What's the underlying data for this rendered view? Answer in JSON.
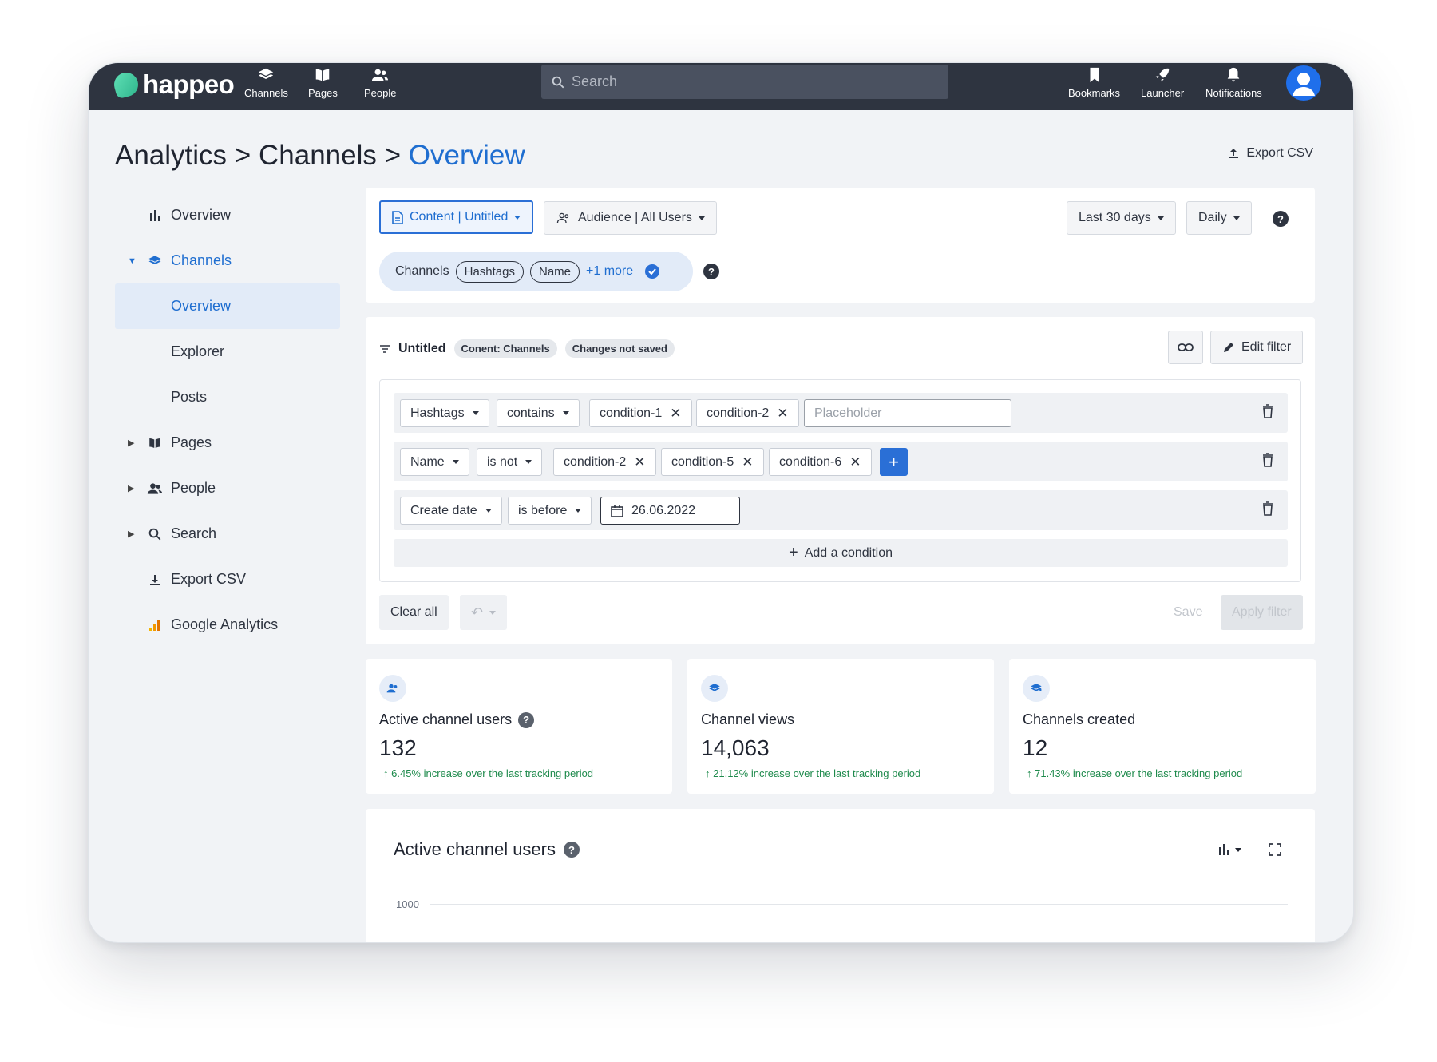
{
  "topbar": {
    "brand": "happeo",
    "nav": [
      "Channels",
      "Pages",
      "People"
    ],
    "search_placeholder": "Search",
    "right_nav": [
      "Bookmarks",
      "Launcher",
      "Notifications"
    ]
  },
  "breadcrumb": {
    "part1": "Analytics",
    "sep": ">",
    "part2": "Channels",
    "current": "Overview"
  },
  "export_csv": "Export CSV",
  "sidebar": {
    "items": [
      {
        "label": "Overview"
      },
      {
        "label": "Channels"
      },
      {
        "label": "Overview"
      },
      {
        "label": "Explorer"
      },
      {
        "label": "Posts"
      },
      {
        "label": "Pages"
      },
      {
        "label": "People"
      },
      {
        "label": "Search"
      },
      {
        "label": "Export CSV"
      },
      {
        "label": "Google Analytics"
      }
    ]
  },
  "filters": {
    "content": "Content | Untitled",
    "audience": "Audience | All Users",
    "range": "Last 30 days",
    "interval": "Daily",
    "channels_label": "Channels",
    "pills": [
      "Hashtags",
      "Name"
    ],
    "more": "+1 more"
  },
  "filter_editor": {
    "title": "Untitled",
    "tag1": "Conent: Channels",
    "tag2": "Changes not saved",
    "edit": "Edit filter",
    "rows": [
      {
        "field": "Hashtags",
        "op": "contains",
        "values": [
          "condition-1",
          "condition-2"
        ],
        "placeholder": "Placeholder"
      },
      {
        "field": "Name",
        "op": "is not",
        "values": [
          "condition-2",
          "condition-5",
          "condition-6"
        ]
      },
      {
        "field": "Create date",
        "op": "is before",
        "date": "26.06.2022"
      }
    ],
    "add_condition": "Add a condition",
    "clear": "Clear all",
    "save": "Save",
    "apply": "Apply filter"
  },
  "stats": [
    {
      "title": "Active channel users",
      "value": "132",
      "delta": "6.45% increase over the last tracking period"
    },
    {
      "title": "Channel views",
      "value": "14,063",
      "delta": "21.12% increase over the last tracking period"
    },
    {
      "title": "Channels created",
      "value": "12",
      "delta": "71.43% increase over the last tracking period"
    }
  ],
  "chart": {
    "title": "Active channel users",
    "ytick": "1000"
  },
  "colors": {
    "accent": "#1f6ed0",
    "topbar": "#2e3440",
    "positive": "#1e8a4c"
  }
}
